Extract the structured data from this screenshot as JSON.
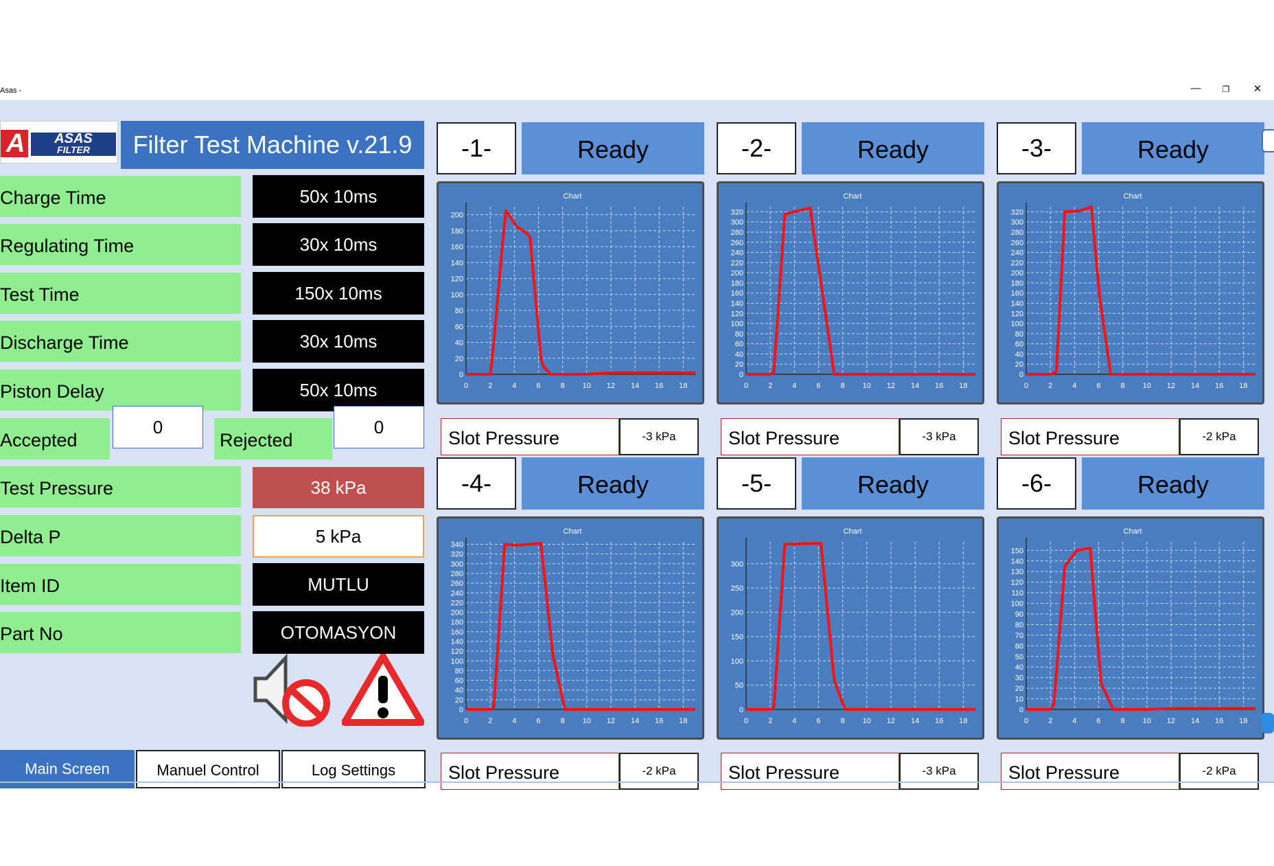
{
  "window": {
    "title": "Asas -",
    "minimize": "—",
    "restore": "❐",
    "close": "✕"
  },
  "logo": {
    "text": "ASAS",
    "subtext": "FILTER",
    "mark": "A"
  },
  "header": {
    "title": "Filter Test Machine v.21.9"
  },
  "params": [
    {
      "label": "Charge Time",
      "value": "50x 10ms"
    },
    {
      "label": "Regulating Time",
      "value": "30x 10ms"
    },
    {
      "label": "Test Time",
      "value": "150x 10ms"
    },
    {
      "label": "Discharge Time",
      "value": "30x 10ms"
    },
    {
      "label": "Piston Delay",
      "value": "50x 10ms"
    }
  ],
  "counts": {
    "accepted_label": "Accepted",
    "accepted_value": "0",
    "rejected_label": "Rejected",
    "rejected_value": "0"
  },
  "test_pressure": {
    "label": "Test Pressure",
    "value": "38 kPa",
    "color": "#c0504d"
  },
  "delta_p": {
    "label": "Delta P",
    "value": "5 kPa"
  },
  "item_id": {
    "label": "Item ID",
    "value": "MUTLU"
  },
  "part_no": {
    "label": "Part No",
    "value": "OTOMASYON"
  },
  "icons": {
    "mute": "speaker-muted-icon",
    "warning": "warning-icon"
  },
  "tabs": [
    {
      "label": "Main Screen",
      "active": true
    },
    {
      "label": "Manuel Control",
      "active": false
    },
    {
      "label": "Log Settings",
      "active": false
    }
  ],
  "slots": [
    {
      "number": "-1-",
      "status": "Ready",
      "pressure_label": "Slot Pressure",
      "pressure_value": "-3 kPa",
      "chart_data": {
        "type": "line",
        "title": "Chart",
        "xlim": [
          0,
          19
        ],
        "ylim": [
          0,
          210
        ],
        "yticks": [
          0,
          20,
          40,
          60,
          80,
          100,
          120,
          140,
          160,
          180,
          200
        ],
        "x": [
          0,
          2,
          2.3,
          3,
          3.3,
          4.2,
          5,
          5.3,
          6.2,
          6.4,
          7,
          8,
          10,
          12,
          14,
          16,
          18,
          19
        ],
        "y": [
          0,
          0,
          40,
          160,
          205,
          185,
          177,
          172,
          20,
          10,
          0,
          0,
          0,
          2,
          2,
          2,
          2,
          2
        ]
      }
    },
    {
      "number": "-2-",
      "status": "Ready",
      "pressure_label": "Slot Pressure",
      "pressure_value": "-3 kPa",
      "chart_data": {
        "type": "line",
        "title": "Chart",
        "xlim": [
          0,
          19
        ],
        "ylim": [
          0,
          330
        ],
        "yticks": [
          0,
          20,
          40,
          60,
          80,
          100,
          120,
          140,
          160,
          180,
          200,
          220,
          240,
          260,
          280,
          300,
          320
        ],
        "x": [
          0,
          2,
          2.3,
          3.2,
          5.3,
          7.3,
          8,
          10,
          12,
          14,
          16,
          18,
          19
        ],
        "y": [
          0,
          0,
          5,
          315,
          328,
          0,
          0,
          0,
          0,
          0,
          0,
          0,
          0
        ]
      }
    },
    {
      "number": "-3-",
      "status": "Ready",
      "pressure_label": "Slot Pressure",
      "pressure_value": "-2 kPa",
      "chart_data": {
        "type": "line",
        "title": "Chart",
        "xlim": [
          0,
          19
        ],
        "ylim": [
          0,
          330
        ],
        "yticks": [
          0,
          20,
          40,
          60,
          80,
          100,
          120,
          140,
          160,
          180,
          200,
          220,
          240,
          260,
          280,
          300,
          320
        ],
        "x": [
          0,
          2,
          2.5,
          3.2,
          4.5,
          5.4,
          6.1,
          7,
          8,
          10,
          12,
          14,
          16,
          18,
          19
        ],
        "y": [
          0,
          0,
          5,
          320,
          322,
          330,
          150,
          0,
          0,
          0,
          0,
          0,
          0,
          0,
          0
        ]
      }
    },
    {
      "number": "-4-",
      "status": "Ready",
      "pressure_label": "Slot Pressure",
      "pressure_value": "-2 kPa",
      "chart_data": {
        "type": "line",
        "title": "Chart",
        "xlim": [
          0,
          19
        ],
        "ylim": [
          0,
          345
        ],
        "yticks": [
          0,
          20,
          40,
          60,
          80,
          100,
          120,
          140,
          160,
          180,
          200,
          220,
          240,
          260,
          280,
          300,
          320,
          340
        ],
        "x": [
          0,
          2,
          2.3,
          3.2,
          4.2,
          6.2,
          7.2,
          8.2,
          10,
          12,
          14,
          16,
          18,
          19
        ],
        "y": [
          0,
          0,
          5,
          340,
          338,
          342,
          110,
          0,
          0,
          0,
          0,
          0,
          0,
          0
        ]
      }
    },
    {
      "number": "-5-",
      "status": "Ready",
      "pressure_label": "Slot Pressure",
      "pressure_value": "-3 kPa",
      "chart_data": {
        "type": "line",
        "title": "Chart",
        "xlim": [
          0,
          19
        ],
        "ylim": [
          0,
          345
        ],
        "yticks": [
          0,
          50,
          100,
          150,
          200,
          250,
          300
        ],
        "x": [
          0,
          2,
          2.3,
          3.2,
          6.2,
          7.3,
          8.2,
          10,
          12,
          14,
          16,
          18,
          19
        ],
        "y": [
          0,
          0,
          5,
          340,
          342,
          60,
          0,
          0,
          0,
          0,
          0,
          0,
          0
        ]
      }
    },
    {
      "number": "-6-",
      "status": "Ready",
      "pressure_label": "Slot Pressure",
      "pressure_value": "-2 kPa",
      "chart_data": {
        "type": "line",
        "title": "Chart",
        "xlim": [
          0,
          19
        ],
        "ylim": [
          0,
          158
        ],
        "yticks": [
          0,
          10,
          20,
          30,
          40,
          50,
          60,
          70,
          80,
          90,
          100,
          110,
          120,
          130,
          140,
          150
        ],
        "x": [
          0,
          2,
          2.3,
          3.2,
          4.2,
          5.3,
          6.2,
          7.2,
          8,
          10,
          12,
          14,
          16,
          18,
          19
        ],
        "y": [
          0,
          0,
          5,
          135,
          150,
          152,
          25,
          0,
          0,
          0,
          1,
          1,
          1,
          1,
          1
        ]
      }
    }
  ],
  "xticks": [
    0,
    2,
    4,
    6,
    8,
    10,
    12,
    14,
    16,
    18
  ]
}
